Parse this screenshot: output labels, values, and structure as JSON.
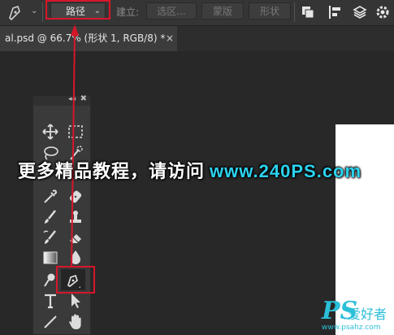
{
  "options_bar": {
    "mode_value": "路径",
    "make_label": "建立:",
    "buttons": [
      "选区...",
      "蒙版",
      "形状"
    ]
  },
  "document_tab": {
    "title": "al.psd @ 66.7% (形状 1, RGB/8) *",
    "close": "×"
  },
  "tool_panel": {
    "collapse": "◂◂",
    "close": "✖"
  },
  "banner": {
    "text": "更多精品教程，请访问",
    "url": "www.240PS.com"
  },
  "logo": {
    "mark": "PS",
    "name": "爱好者",
    "site": "www.psahz.com"
  },
  "colors": {
    "highlight": "#d7162a",
    "accent_cyan": "#2bd3ef"
  }
}
